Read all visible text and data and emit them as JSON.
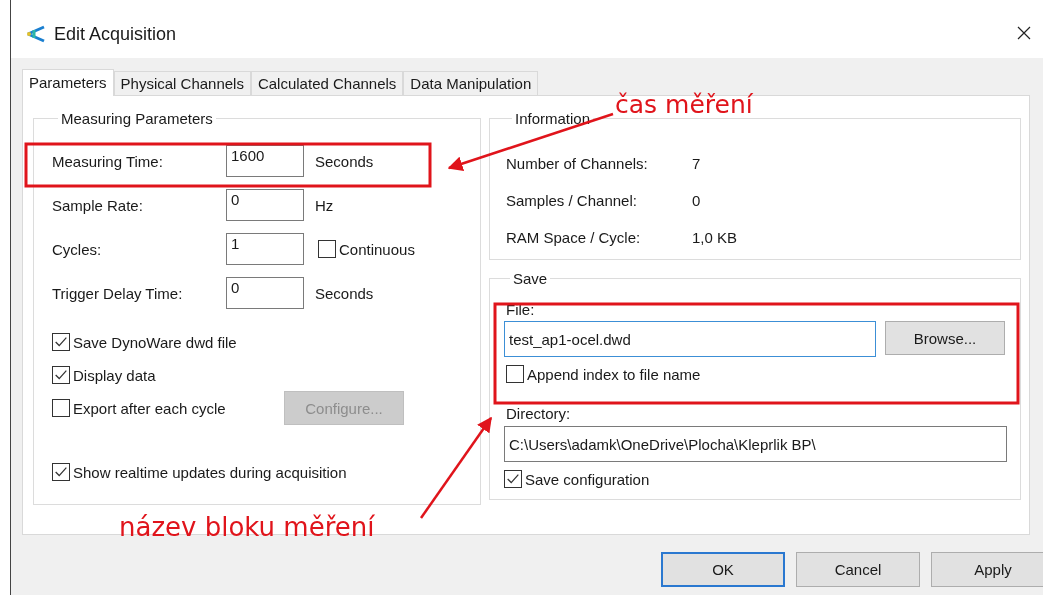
{
  "window": {
    "title": "Edit Acquisition"
  },
  "tabs": [
    {
      "label": "Parameters",
      "selected": true
    },
    {
      "label": "Physical Channels",
      "selected": false
    },
    {
      "label": "Calculated Channels",
      "selected": false
    },
    {
      "label": "Data Manipulation",
      "selected": false
    }
  ],
  "measuring_parameters": {
    "title": "Measuring Parameters",
    "fields": [
      {
        "kind": "unit",
        "label": "Measuring Time:",
        "value": "1600",
        "unit": "Seconds"
      },
      {
        "kind": "unit",
        "label": "Sample Rate:",
        "value": "0",
        "unit": "Hz"
      },
      {
        "kind": "checkbox",
        "label": "Cycles:",
        "value": "1",
        "checkbox": {
          "label": "Continuous",
          "checked": false
        }
      },
      {
        "kind": "unit",
        "label": "Trigger Delay Time:",
        "value": "0",
        "unit": "Seconds"
      }
    ],
    "options": [
      {
        "label": "Save DynoWare dwd file",
        "checked": true
      },
      {
        "label": "Display data",
        "checked": true
      },
      {
        "label": "Export after each cycle",
        "checked": false,
        "button": {
          "label": "Configure...",
          "disabled": true
        }
      }
    ],
    "realtime": {
      "label": "Show realtime updates during acquisition",
      "checked": true
    }
  },
  "information": {
    "title": "Information",
    "rows": [
      {
        "label": "Number of Channels:",
        "value": "7"
      },
      {
        "label": "Samples / Channel:",
        "value": "0"
      },
      {
        "label": "RAM Space / Cycle:",
        "value": "1,0 KB"
      }
    ]
  },
  "save": {
    "title": "Save",
    "file_label": "File:",
    "file_value": "test_ap1-ocel.dwd",
    "browse": "Browse...",
    "append": {
      "label": "Append index to file name",
      "checked": false
    },
    "directory_label": "Directory:",
    "directory_value": "C:\\Users\\adamk\\OneDrive\\Plocha\\Kleprlik BP\\",
    "save_configuration": {
      "label": "Save configuration",
      "checked": true
    }
  },
  "buttons": [
    {
      "label": "OK",
      "default": true
    },
    {
      "label": "Cancel",
      "default": false
    },
    {
      "label": "Apply",
      "default": false
    }
  ],
  "annotations": [
    {
      "text": "čas měření"
    },
    {
      "text": "název bloku měření"
    }
  ]
}
